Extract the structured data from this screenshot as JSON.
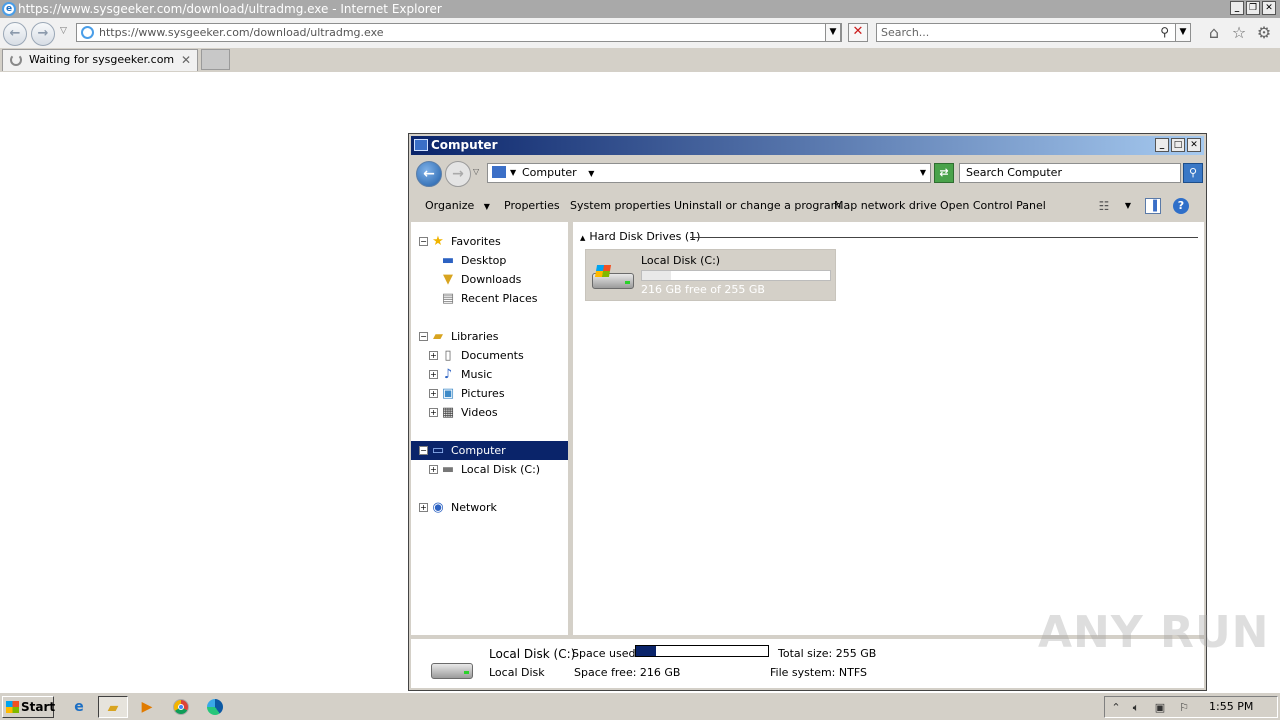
{
  "browser": {
    "window_title": "https://www.sysgeeker.com/download/ultradmg.exe - Internet Explorer",
    "url": "https://www.sysgeeker.com/download/ultradmg.exe",
    "search_placeholder": "Search...",
    "tab_label": "Waiting for sysgeeker.com"
  },
  "explorer": {
    "title": "Computer",
    "path_label": "Computer",
    "search_placeholder": "Search Computer",
    "commands": [
      "Organize",
      "Properties",
      "System properties",
      "Uninstall or change a program",
      "Map network drive",
      "Open Control Panel"
    ],
    "tree": {
      "favorites": "Favorites",
      "desktop": "Desktop",
      "downloads": "Downloads",
      "recent_places": "Recent Places",
      "libraries": "Libraries",
      "documents": "Documents",
      "music": "Music",
      "pictures": "Pictures",
      "videos": "Videos",
      "computer": "Computer",
      "local_disk": "Local Disk (C:)",
      "network": "Network"
    },
    "group_header": "Hard Disk Drives (1)",
    "drive": {
      "name": "Local Disk (C:)",
      "free_text": "216 GB free of 255 GB",
      "used_fraction": 0.153
    },
    "details": {
      "name": "Local Disk (C:)",
      "type": "Local Disk",
      "space_used_label": "Space used:",
      "space_free": "Space free: 216 GB",
      "total_size": "Total size: 255 GB",
      "file_system": "File system: NTFS"
    }
  },
  "watermark": "ANY RUN",
  "taskbar": {
    "start_label": "Start",
    "apps": [
      "internet-explorer",
      "windows-explorer",
      "media-player",
      "chrome",
      "edge"
    ],
    "clock": "1:55 PM"
  }
}
